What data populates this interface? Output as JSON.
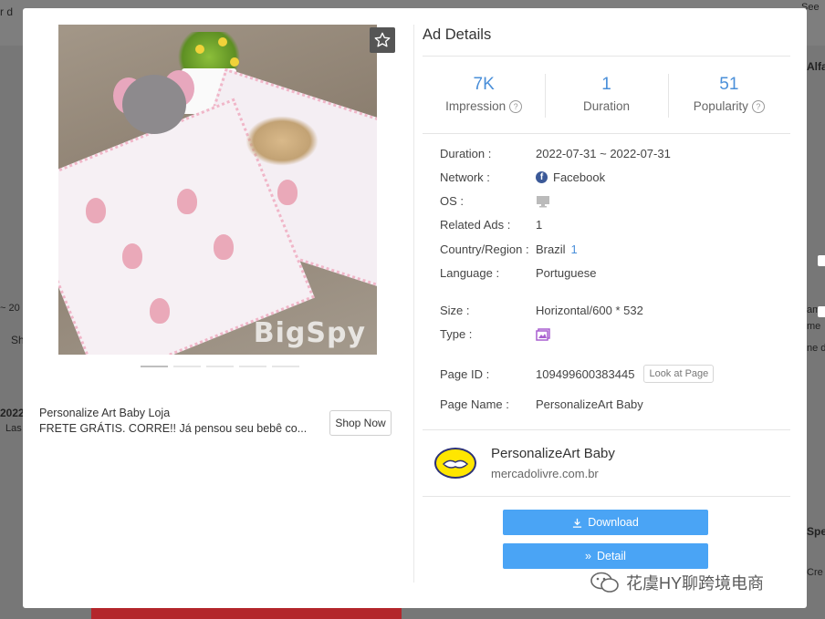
{
  "background": {
    "left_texts": [
      "r d",
      "2022",
      "Las",
      "Sh",
      "~ 20"
    ],
    "right_texts": [
      "Alfa",
      "am",
      "me",
      "ne d",
      "Spe",
      "Cre",
      "See"
    ]
  },
  "ad_preview": {
    "watermark": "BigSpy",
    "carousel_count": 5,
    "carousel_active": 0,
    "caption_title": "Personalize Art Baby Loja",
    "caption_text": "FRETE GRÁTIS. CORRE!! Já pensou seu bebê co...",
    "shop_button": "Shop Now"
  },
  "panel": {
    "title": "Ad Details",
    "stats": [
      {
        "value": "7K",
        "label": "Impression",
        "help": true
      },
      {
        "value": "1",
        "label": "Duration",
        "help": false
      },
      {
        "value": "51",
        "label": "Popularity",
        "help": true
      }
    ],
    "details": {
      "duration_label": "Duration :",
      "duration_value": "2022-07-31 ~ 2022-07-31",
      "network_label": "Network :",
      "network_value": "Facebook",
      "os_label": "OS :",
      "related_label": "Related Ads :",
      "related_value": "1",
      "country_label": "Country/Region :",
      "country_value": "Brazil",
      "country_count": "1",
      "language_label": "Language :",
      "language_value": "Portuguese",
      "size_label": "Size :",
      "size_value": "Horizontal/600 * 532",
      "type_label": "Type :",
      "pageid_label": "Page ID :",
      "pageid_value": "109499600383445",
      "look_button": "Look at Page",
      "pagename_label": "Page Name :",
      "pagename_value": "PersonalizeArt Baby"
    },
    "advertiser": {
      "name": "PersonalizeArt Baby",
      "domain": "mercadolivre.com.br"
    },
    "download_button": "Download",
    "detail_button": "Detail"
  },
  "overlay_watermark": "花虞HY聊跨境电商",
  "colors": {
    "accent": "#4a8fd9",
    "button_blue": "#4aa4f5",
    "facebook": "#3b5998",
    "mercado_yellow": "#ffe600"
  }
}
